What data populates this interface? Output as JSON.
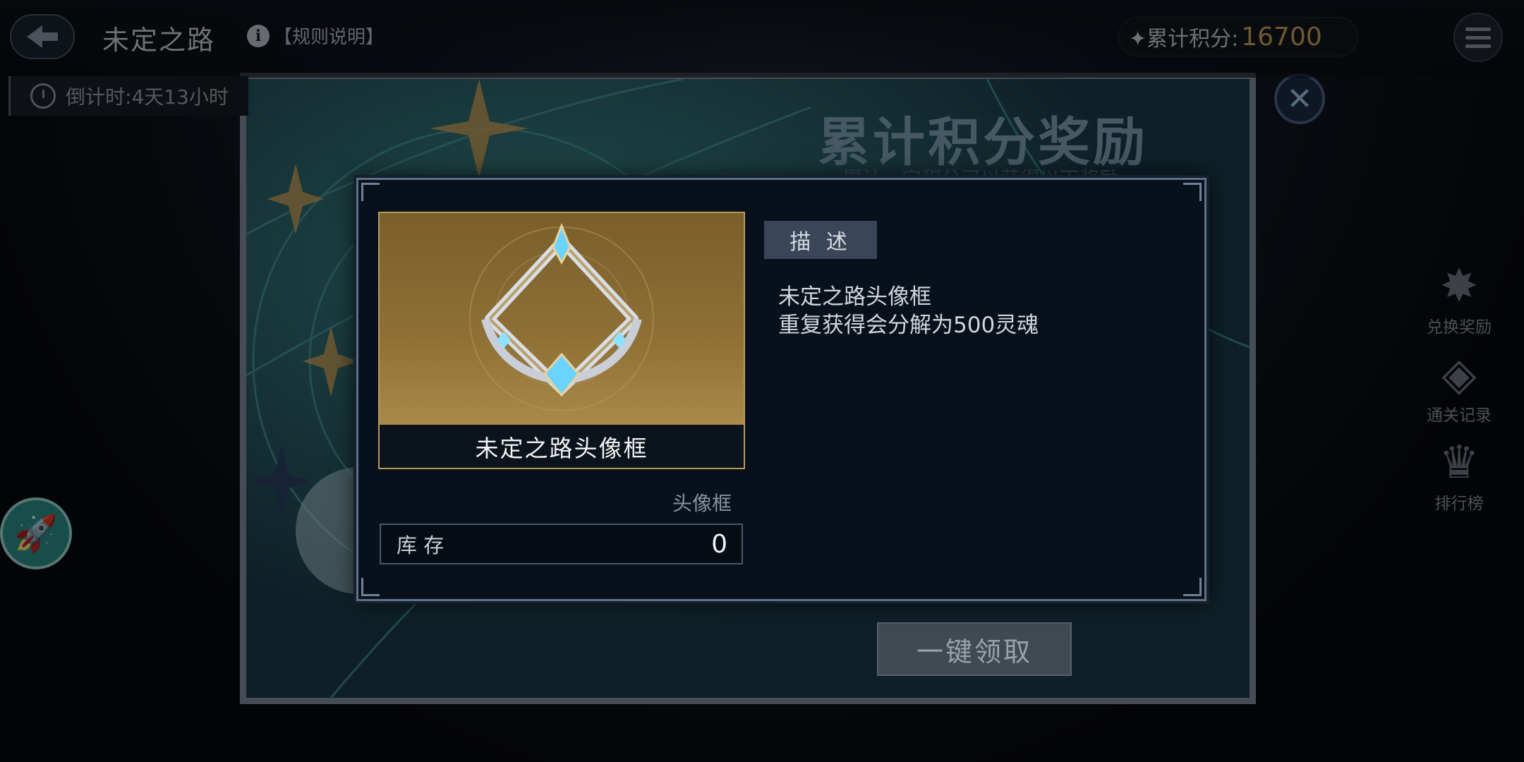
{
  "header": {
    "title": "未定之路",
    "rules_label": "【规则说明】",
    "info_glyph": "i",
    "score_label": "✦累计积分:",
    "score_value": "16700",
    "timer_label": "倒计时:",
    "timer_value": "4天13小时"
  },
  "side_menu": [
    {
      "label": "兑换奖励",
      "icon": "star-badge-icon",
      "glyph": "✸"
    },
    {
      "label": "通关记录",
      "icon": "card-record-icon",
      "glyph": "◈"
    },
    {
      "label": "排行榜",
      "icon": "crown-icon",
      "glyph": "♛"
    }
  ],
  "rocket_glyph": "🚀",
  "panel": {
    "title": "累计积分奖励",
    "subtitle": "累计一定积分可以获得以下奖励",
    "claim_all_label": "一键领取",
    "close_glyph": "✕"
  },
  "dialog": {
    "item_name": "未定之路头像框",
    "item_type": "头像框",
    "stock_label": "库 存",
    "stock_value": "0",
    "desc_tab": "描 述",
    "desc_lines": [
      "未定之路头像框",
      "重复获得会分解为500灵魂"
    ]
  },
  "colors": {
    "accent_gold": "#c9a15b",
    "panel_teal": "#2b6d74",
    "dialog_bg": "#08111b"
  }
}
